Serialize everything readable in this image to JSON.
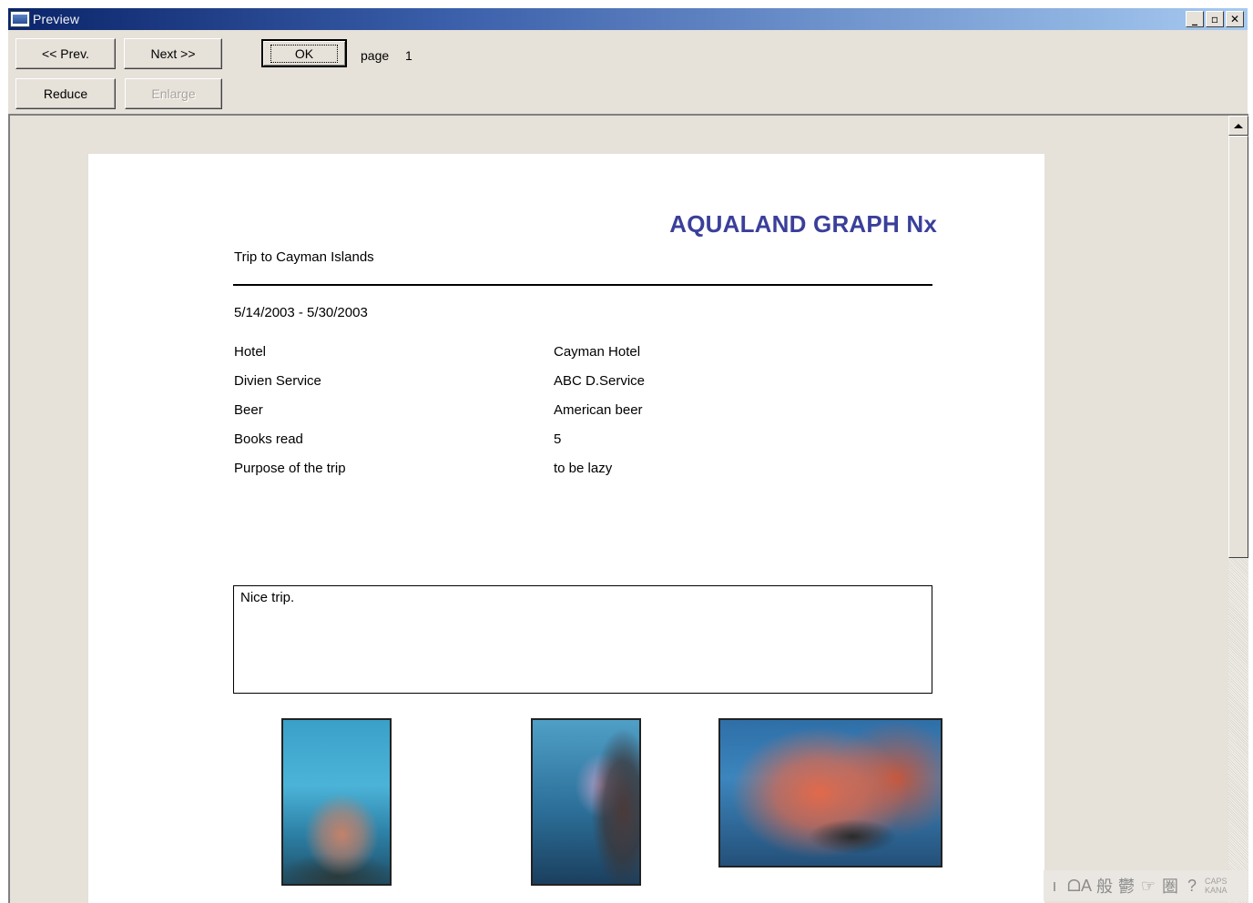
{
  "window": {
    "title": "Preview"
  },
  "title_buttons": {
    "minimize": "_",
    "restore": "▫",
    "close": "✕"
  },
  "toolbar": {
    "prev_label": "<< Prev.",
    "next_label": "Next >>",
    "ok_label": "OK",
    "reduce_label": "Reduce",
    "enlarge_label": "Enlarge",
    "page_label": "page",
    "page_number": "1"
  },
  "report": {
    "brand": "AQUALAND GRAPH Nx",
    "trip_title": "Trip to Cayman Islands",
    "date_range": "5/14/2003 - 5/30/2003",
    "rows": [
      {
        "label": "Hotel",
        "value": "Cayman Hotel"
      },
      {
        "label": "Divien Service",
        "value": "ABC D.Service"
      },
      {
        "label": "Beer",
        "value": "American beer"
      },
      {
        "label": "Books read",
        "value": "5"
      },
      {
        "label": "Purpose of the trip",
        "value": "to be lazy"
      }
    ],
    "memo": "Nice trip."
  },
  "photos": [
    {
      "icon": "coral-reef-photo"
    },
    {
      "icon": "diver-reef-photo"
    },
    {
      "icon": "sea-fan-fish-photo"
    }
  ],
  "ime_bar": {
    "items": [
      "ı",
      "ᗝA",
      "般",
      "鬱",
      "☞",
      "圏",
      "?"
    ],
    "caps": "CAPS",
    "kana": "KANA"
  },
  "colors": {
    "brand_color": "#3a3f9a",
    "titlebar_start": "#0a246a",
    "titlebar_end": "#a6caf0",
    "window_bg": "#e6e1d9"
  }
}
